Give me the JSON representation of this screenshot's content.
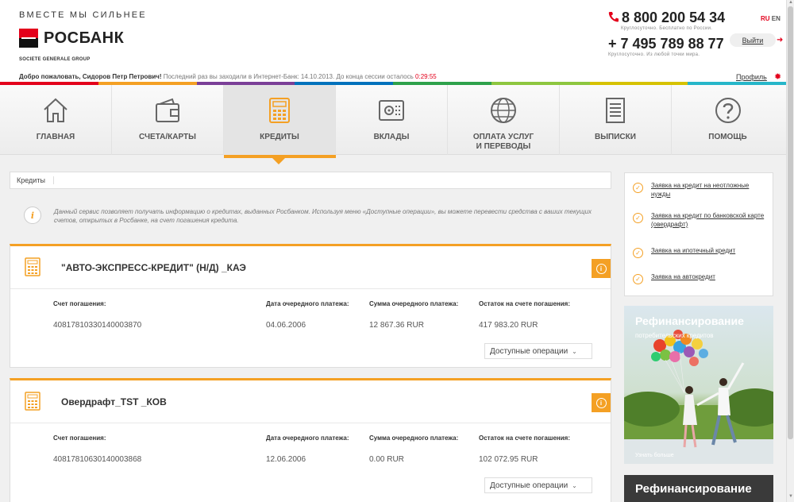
{
  "header": {
    "slogan": "ВМЕСТЕ МЫ СИЛЬНЕЕ",
    "logo_text": "РОСБАНК",
    "logo_sub": "SOCIETE GENERALE GROUP",
    "welcome": "Добро пожаловать, Сидоров Петр Петрович!",
    "last_visit": "Последний раз вы заходили в Интернет-Банк: 14.10.2013.",
    "session_label": "До конца сессии осталось",
    "session_timer": "0:29:55",
    "phone1": "8 800 200 54 34",
    "phone1_note": "Круглосуточно. Бесплатно по России.",
    "phone2": "+ 7 495 789 88 77",
    "phone2_note": "Круглосуточно. Из любой точки мира.",
    "lang_ru": "RU",
    "lang_en": "EN",
    "logout": "Выйти",
    "profile": "Профиль",
    "strip_colors": [
      "#e3001b",
      "#f4a024",
      "#7a3f97",
      "#0072bc",
      "#2ea14b",
      "#8dc63f",
      "#d6c200",
      "#26b6c9"
    ]
  },
  "nav": {
    "items": [
      {
        "label": "ГЛАВНАЯ",
        "icon": "home-icon"
      },
      {
        "label": "СЧЕТА/КАРТЫ",
        "icon": "wallet-icon"
      },
      {
        "label": "КРЕДИТЫ",
        "icon": "calculator-icon"
      },
      {
        "label": "ВКЛАДЫ",
        "icon": "safe-icon"
      },
      {
        "label_line1": "ОПЛАТА УСЛУГ",
        "label_line2": "И ПЕРЕВОДЫ",
        "icon": "globe-icon"
      },
      {
        "label": "ВЫПИСКИ",
        "icon": "document-icon"
      },
      {
        "label": "ПОМОЩЬ",
        "icon": "help-icon"
      }
    ],
    "active_color": "#f4a024"
  },
  "breadcrumb": "Кредиты",
  "info_text": "Данный сервис позволяет получать информацию о кредитах, выданных Росбанком. Используя меню «Доступные операции», вы можете перевести средства с ваших текущих счетов, открытых в Росбанке, на счет погашения кредита.",
  "columns": {
    "account": "Счет погашения:",
    "date": "Дата очередного платежа:",
    "amount": "Сумма очередного платежа:",
    "balance": "Остаток на счете погашения:"
  },
  "credits": [
    {
      "title": "\"АВТО-ЭКСПРЕСС-КРЕДИТ\" (Н/Д) _КАЭ",
      "account": "40817810330140003870",
      "date": "04.06.2006",
      "amount": "12 867.36 RUR",
      "balance": "417 983.20 RUR",
      "ops": "Доступные операции"
    },
    {
      "title": "Овердрафт_TST _КОВ",
      "account": "40817810630140003868",
      "date": "12.06.2006",
      "amount": "0.00 RUR",
      "balance": "102 072.95 RUR",
      "ops": "Доступные операции"
    }
  ],
  "sidebar": {
    "links": [
      "Заявка на кредит на неотложные нужды",
      "Заявка на кредит по банковской карте (овердрафт)",
      "Заявка на ипотечный кредит",
      "Заявка на автокредит"
    ]
  },
  "banner": {
    "title": "Рефинансирование",
    "subtitle": "потребительских кредитов",
    "more": "Узнать больше"
  },
  "banner2": {
    "title": "Рефинансирование"
  }
}
